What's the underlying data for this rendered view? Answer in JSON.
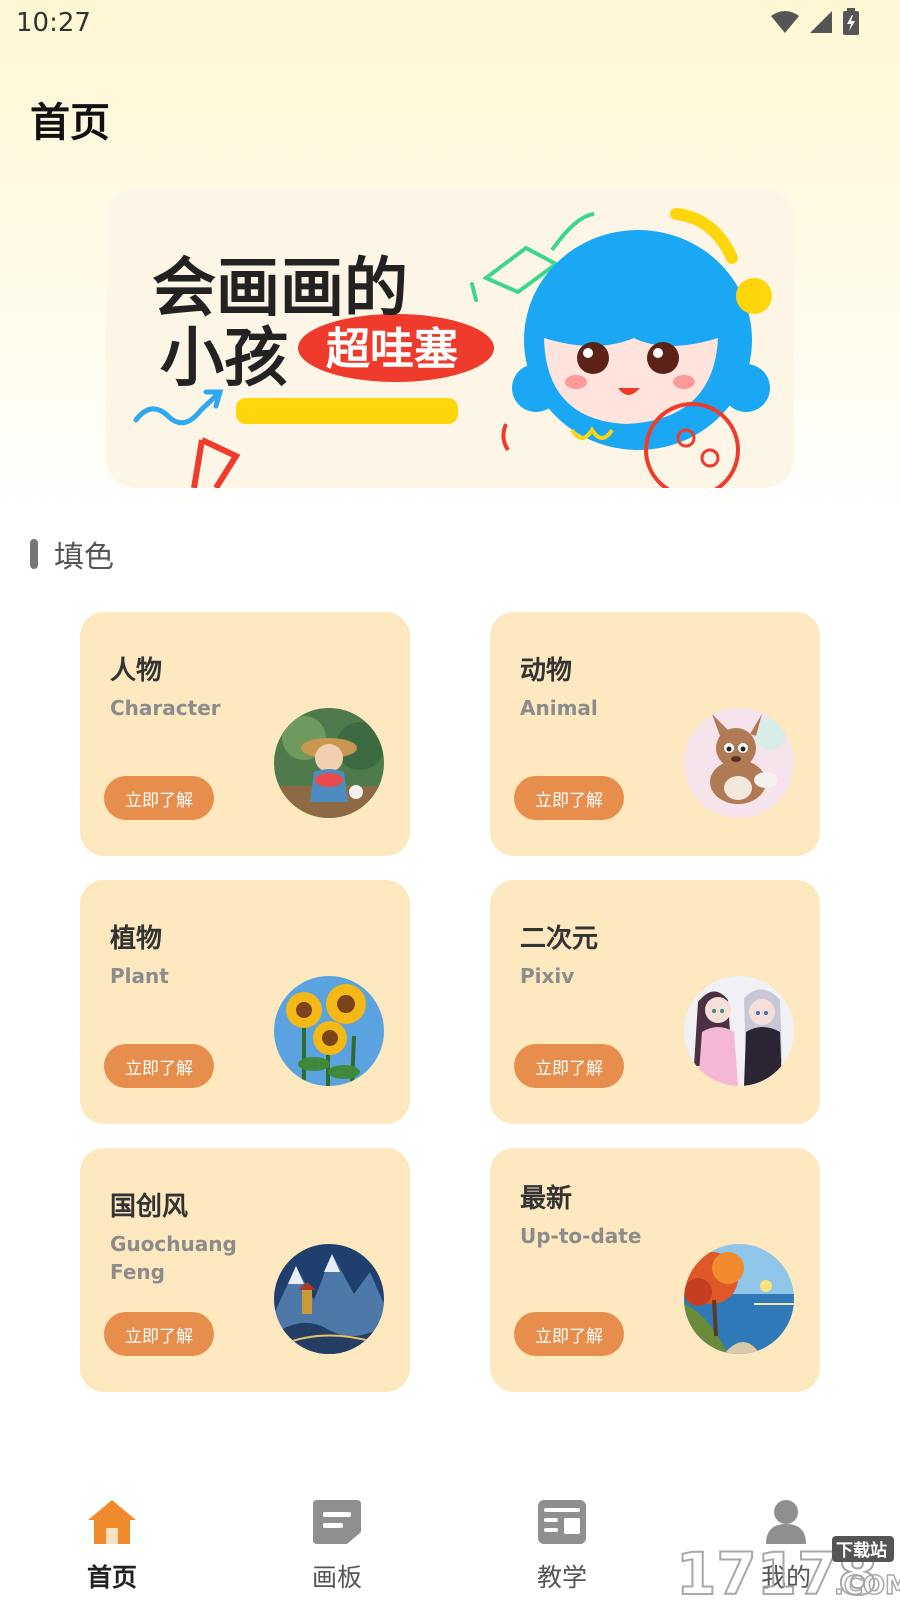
{
  "status_bar": {
    "time": "10:27"
  },
  "page": {
    "title": "首页"
  },
  "banner": {
    "line1": "会画画的",
    "line2": "小孩",
    "badge": "超哇塞"
  },
  "section": {
    "title": "填色"
  },
  "cards": [
    {
      "title": "人物",
      "subtitle": "Character",
      "button": "立即了解"
    },
    {
      "title": "动物",
      "subtitle": "Animal",
      "button": "立即了解"
    },
    {
      "title": "植物",
      "subtitle": "Plant",
      "button": "立即了解"
    },
    {
      "title": "二次元",
      "subtitle": "Pixiv",
      "button": "立即了解"
    },
    {
      "title": "国创风",
      "subtitle": "Guochuang Feng",
      "button": "立即了解"
    },
    {
      "title": "最新",
      "subtitle": "Up-to-date",
      "button": "立即了解"
    }
  ],
  "nav": {
    "items": [
      {
        "label": "首页",
        "icon": "home-icon",
        "active": true
      },
      {
        "label": "画板",
        "icon": "drawing-board-icon",
        "active": false
      },
      {
        "label": "教学",
        "icon": "tutorial-icon",
        "active": false
      },
      {
        "label": "我的",
        "icon": "profile-icon",
        "active": false
      }
    ]
  },
  "watermark": {
    "text": "17178",
    "badge": "下载站",
    "suffix": ".COM"
  },
  "colors": {
    "accent": "#f08a2c",
    "card_bg": "#fde8c0",
    "button_bg": "#e78e4c"
  }
}
